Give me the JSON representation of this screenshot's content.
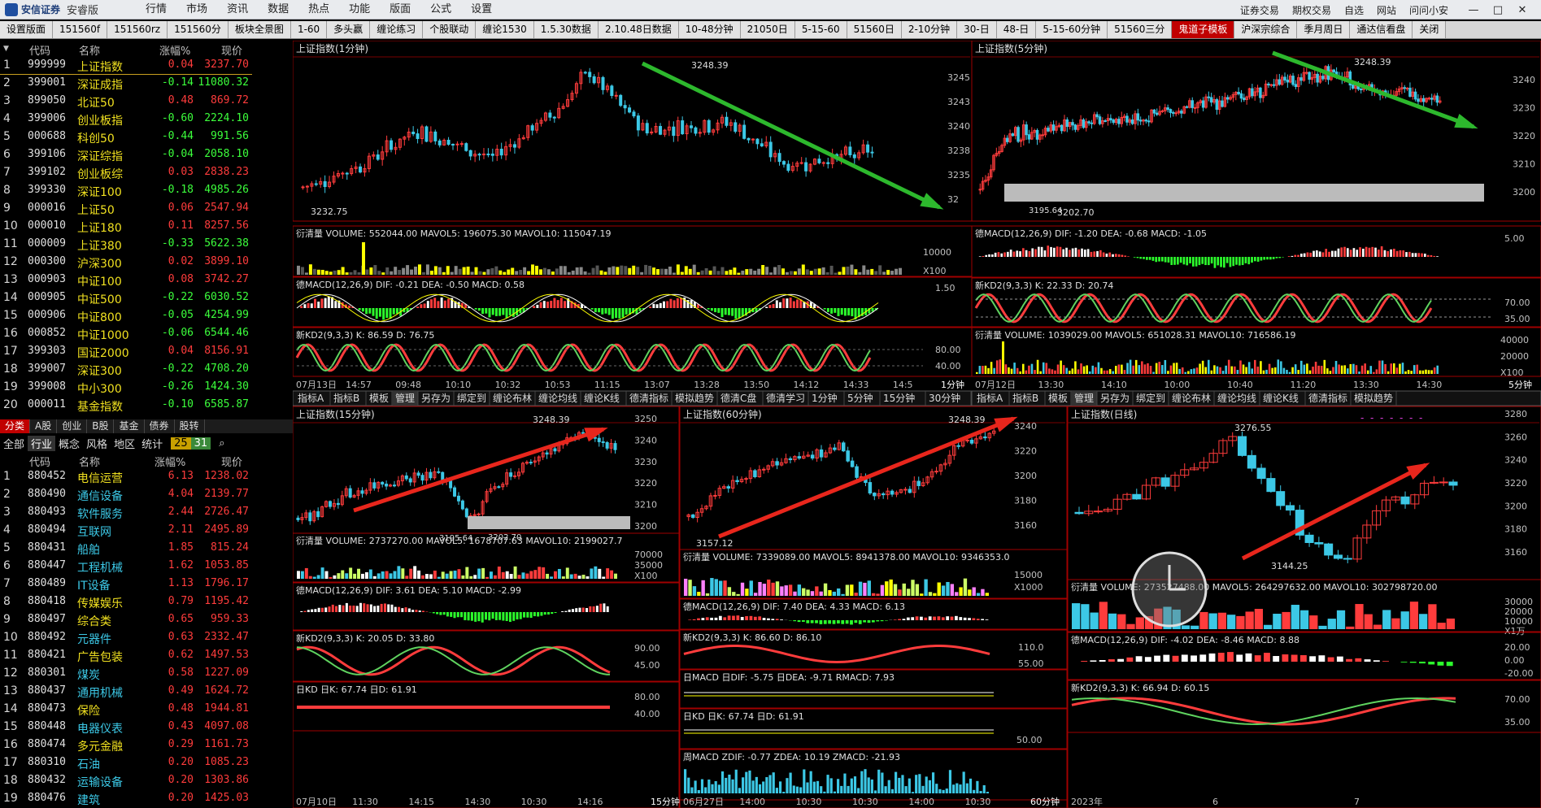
{
  "app": {
    "logo": "安信证券",
    "edition": "安睿版"
  },
  "menu": [
    "行情",
    "市场",
    "资讯",
    "数据",
    "热点",
    "功能",
    "版面",
    "公式",
    "设置"
  ],
  "top_right": [
    "证券交易",
    "期权交易",
    "自选",
    "网站",
    "问问小安"
  ],
  "tabs": [
    "设置版面",
    "151560f",
    "151560rz",
    "151560分",
    "板块全景图",
    "1-60",
    "多头赢",
    "缠论练习",
    "个股联动",
    "缠论1530",
    "1.5.30数据",
    "2.10.48日数据",
    "10-48分钟",
    "21050日",
    "5-15-60",
    "51560日",
    "2-10分钟",
    "30-日",
    "48-日",
    "5-15-60分钟",
    "51560三分",
    "鬼道子模板",
    "沪深宗综合",
    "季月周日",
    "通达信看盘",
    "关闭"
  ],
  "active_tab": "鬼道子模板",
  "list1": {
    "headers": [
      "代码",
      "名称",
      "涨幅%",
      "现价"
    ],
    "rows": [
      [
        "1",
        "999999",
        "上证指数",
        "0.04",
        "3237.70"
      ],
      [
        "2",
        "399001",
        "深证成指",
        "-0.14",
        "11080.32"
      ],
      [
        "3",
        "899050",
        "北证50",
        "0.48",
        "869.72"
      ],
      [
        "4",
        "399006",
        "创业板指",
        "-0.60",
        "2224.10"
      ],
      [
        "5",
        "000688",
        "科创50",
        "-0.44",
        "991.56"
      ],
      [
        "6",
        "399106",
        "深证综指",
        "-0.04",
        "2058.10"
      ],
      [
        "7",
        "399102",
        "创业板综",
        "0.03",
        "2838.23"
      ],
      [
        "8",
        "399330",
        "深证100",
        "-0.18",
        "4985.26"
      ],
      [
        "9",
        "000016",
        "上证50",
        "0.06",
        "2547.94"
      ],
      [
        "10",
        "000010",
        "上证180",
        "0.11",
        "8257.56"
      ],
      [
        "11",
        "000009",
        "上证380",
        "-0.33",
        "5622.38"
      ],
      [
        "12",
        "000300",
        "沪深300",
        "0.02",
        "3899.10"
      ],
      [
        "13",
        "000903",
        "中证100",
        "0.08",
        "3742.27"
      ],
      [
        "14",
        "000905",
        "中证500",
        "-0.22",
        "6030.52"
      ],
      [
        "15",
        "000906",
        "中证800",
        "-0.05",
        "4254.99"
      ],
      [
        "16",
        "000852",
        "中证1000",
        "-0.06",
        "6544.46"
      ],
      [
        "17",
        "399303",
        "国证2000",
        "0.04",
        "8156.91"
      ],
      [
        "18",
        "399007",
        "深证300",
        "-0.22",
        "4708.20"
      ],
      [
        "19",
        "399008",
        "中小300",
        "-0.26",
        "1424.30"
      ],
      [
        "20",
        "000011",
        "基金指数",
        "-0.10",
        "6585.87"
      ]
    ]
  },
  "catbar": [
    "分类",
    "A股",
    "创业",
    "B股",
    "基金",
    "债券",
    "股转"
  ],
  "subtabs": [
    "全部",
    "行业",
    "概念",
    "风格",
    "地区",
    "统计"
  ],
  "subtab_counts": [
    "25",
    "31"
  ],
  "list2": {
    "headers": [
      "代码",
      "名称",
      "涨幅%",
      "现价"
    ],
    "rows": [
      [
        "1",
        "880452",
        "电信运营",
        "6.13",
        "1238.02"
      ],
      [
        "2",
        "880490",
        "通信设备",
        "4.04",
        "2139.77"
      ],
      [
        "3",
        "880493",
        "软件服务",
        "2.44",
        "2726.47"
      ],
      [
        "4",
        "880494",
        "互联网",
        "2.11",
        "2495.89"
      ],
      [
        "5",
        "880431",
        "船舶",
        "1.85",
        "815.24"
      ],
      [
        "6",
        "880447",
        "工程机械",
        "1.62",
        "1053.85"
      ],
      [
        "7",
        "880489",
        "IT设备",
        "1.13",
        "1796.17"
      ],
      [
        "8",
        "880418",
        "传媒娱乐",
        "0.79",
        "1195.42"
      ],
      [
        "9",
        "880497",
        "综合类",
        "0.65",
        "959.33"
      ],
      [
        "10",
        "880492",
        "元器件",
        "0.63",
        "2332.47"
      ],
      [
        "11",
        "880421",
        "广告包装",
        "0.62",
        "1497.53"
      ],
      [
        "12",
        "880301",
        "煤炭",
        "0.58",
        "1227.09"
      ],
      [
        "13",
        "880437",
        "通用机械",
        "0.49",
        "1624.72"
      ],
      [
        "14",
        "880473",
        "保险",
        "0.48",
        "1944.81"
      ],
      [
        "15",
        "880448",
        "电器仪表",
        "0.43",
        "4097.08"
      ],
      [
        "16",
        "880474",
        "多元金融",
        "0.29",
        "1161.73"
      ],
      [
        "17",
        "880310",
        "石油",
        "0.20",
        "1085.23"
      ],
      [
        "18",
        "880432",
        "运输设备",
        "0.20",
        "1303.86"
      ],
      [
        "19",
        "880476",
        "建筑",
        "0.20",
        "1425.03"
      ]
    ]
  },
  "charts": {
    "c1": {
      "title": "上证指数(1分钟)",
      "hi": "3248.39",
      "lo": "3232.75",
      "axis": [
        "3245",
        "3243",
        "3240",
        "3238",
        "3235",
        "32"
      ],
      "vol": "衍清量  VOLUME: 552044.00  MAVOL5: 196075.30  MAVOL10: 115047.19",
      "vol_axis": [
        "10000",
        "X100"
      ],
      "macd": "德MACD(12,26,9)  DIF: -0.21  DEA: -0.50  MACD: 0.58",
      "macd_axis": "1.50",
      "kd": "新KD2(9,3,3)  K: 86.59  D: 76.75",
      "kd_axis": [
        "80.00",
        "40.00"
      ],
      "time": [
        "07月13日",
        "14:57",
        "09:48",
        "10:10",
        "10:32",
        "10:53",
        "11:15",
        "13:07",
        "13:28",
        "13:50",
        "14:12",
        "14:33",
        "14:5"
      ],
      "period": "1分钟",
      "tabs": [
        "指标A",
        "指标B",
        "模板",
        "管理",
        "另存为",
        "绑定到",
        "缠论布林",
        "缠论均线",
        "缠论K线",
        "德清指标",
        "模拟趋势",
        "德清C盘",
        "德清学习",
        "1分钟",
        "5分钟",
        "15分钟",
        "30分钟"
      ]
    },
    "c2": {
      "title": "上证指数(5分钟)",
      "hi": "3248.39",
      "lo": "3202.70",
      "lo2": "3195.64",
      "axis": [
        "3240",
        "3230",
        "3220",
        "3210",
        "3200"
      ],
      "macd": "德MACD(12,26,9)  DIF: -1.20  DEA: -0.68  MACD: -1.05",
      "macd_axis": "5.00",
      "kd": "新KD2(9,3,3)  K: 22.33  D: 20.74",
      "kd_axis": [
        "70.00",
        "35.00"
      ],
      "vol": "衍清量  VOLUME: 1039029.00  MAVOL5: 651028.31  MAVOL10: 716586.19",
      "vol_axis": [
        "40000",
        "20000",
        "X100"
      ],
      "time": [
        "07月12日",
        "13:30",
        "14:10",
        "10:00",
        "10:40",
        "11:20",
        "13:30",
        "14:30"
      ],
      "period": "5分钟",
      "tabs": [
        "指标A",
        "指标B",
        "模板",
        "管理",
        "另存为",
        "绑定到",
        "缠论布林",
        "缠论均线",
        "缠论K线",
        "德清指标",
        "模拟趋势"
      ]
    },
    "c3": {
      "title": "上证指数(15分钟)",
      "hi": "3248.39",
      "lo": "3195.64",
      "lo2": "3202.70",
      "axis": [
        "3250",
        "3240",
        "3230",
        "3220",
        "3210",
        "3200"
      ],
      "vol": "衍清量  VOLUME: 2737270.00  MAVOL5: 1678707.63  MAVOL10: 2199027.7",
      "vol_axis": [
        "70000",
        "35000",
        "X100"
      ],
      "macd": "德MACD(12,26,9)  DIF: 3.61  DEA: 5.10  MACD: -2.99",
      "kd": "新KD2(9,3,3)  K: 20.05  D: 33.80",
      "kd_axis": [
        "90.00",
        "45.00"
      ],
      "rkd": "日KD  日K: 67.74  日D: 61.91",
      "rkd_axis": [
        "80.00",
        "40.00"
      ],
      "time": [
        "07月10日",
        "11:30",
        "14:15",
        "14:30",
        "10:30",
        "14:16"
      ],
      "period": "15分钟"
    },
    "c4": {
      "title": "上证指数(60分钟)",
      "hi": "3248.39",
      "lo": "3157.12",
      "axis": [
        "3240",
        "3220",
        "3200",
        "3180",
        "3160"
      ],
      "vol": "衍清量  VOLUME: 7339089.00  MAVOL5: 8941378.00  MAVOL10: 9346353.0",
      "vol_axis": [
        "15000",
        "X1000"
      ],
      "macd": "德MACD(12,26,9)  DIF: 7.40  DEA: 4.33  MACD: 6.13",
      "kd": "新KD2(9,3,3)  K: 86.60  D: 86.10",
      "kd_axis": [
        "110.0",
        "55.00"
      ],
      "rmacd": "日MACD  日DIF: -5.75  日DEA: -9.71  RMACD: 7.93",
      "rkd": "日KD  日K: 67.74  日D: 61.91",
      "rkd_axis": "50.00",
      "wmacd": "周MACD  ZDIF: -0.77  ZDEA: 10.19  ZMACD: -21.93",
      "time": [
        "06月27日",
        "14:00",
        "10:30",
        "10:30",
        "14:00",
        "10:30"
      ],
      "period": "60分钟"
    },
    "c5": {
      "title": "上证指数(日线)",
      "hi": "3276.55",
      "lo": "3144.25",
      "axis": [
        "3280",
        "3260",
        "3240",
        "3220",
        "3200",
        "3180",
        "3160"
      ],
      "vol": "衍清量  VOLUME: 273527488.00  MAVOL5: 264297632.00  MAVOL10: 302798720.00",
      "vol_axis": [
        "30000",
        "20000",
        "10000",
        "X1万"
      ],
      "macd": "德MACD(12,26,9)  DIF: -4.02  DEA: -8.46  MACD: 8.88",
      "macd_axis": [
        "20.00",
        "0.00",
        "-20.00"
      ],
      "kd": "新KD2(9,3,3)  K: 66.94  D: 60.15",
      "kd_axis": [
        "70.00",
        "35.00"
      ],
      "time": [
        "2023年",
        "6",
        "7"
      ],
      "period": "日线"
    }
  },
  "colors": {
    "up": "#ff3c3c",
    "down": "#3cc8e6",
    "grid": "#8b0000",
    "frame": "#a00000",
    "arrow_green": "#2db82d",
    "arrow_red": "#e8261c",
    "bg": "#000000"
  }
}
